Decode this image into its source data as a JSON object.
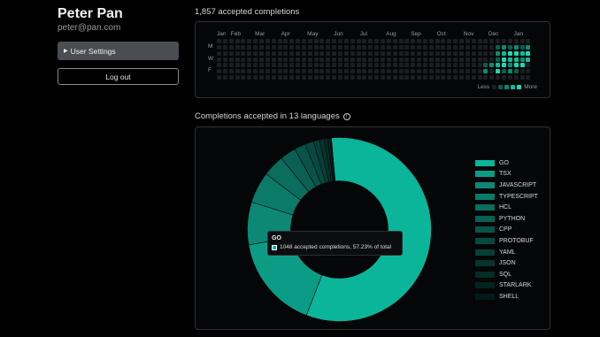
{
  "user": {
    "name": "Peter Pan",
    "email": "peter@pan.com",
    "settings_label": "User Settings",
    "logout_label": "Log out"
  },
  "activity": {
    "title": "1,857 accepted completions",
    "months": [
      "Jan",
      "Feb",
      "Mar",
      "Apr",
      "May",
      "Jun",
      "Jul",
      "Aug",
      "Sep",
      "Oct",
      "Nov",
      "Dec",
      "Jan"
    ],
    "day_labels": [
      "M",
      "W",
      "F"
    ],
    "legend_less": "Less",
    "legend_more": "More",
    "weeks": 52,
    "levels_by_week": {
      "44": [
        0,
        0,
        0,
        0,
        1,
        2,
        0
      ],
      "45": [
        0,
        0,
        0,
        0,
        2,
        0,
        0
      ],
      "46": [
        0,
        1,
        2,
        1,
        3,
        4,
        0
      ],
      "47": [
        0,
        2,
        3,
        4,
        4,
        1,
        0
      ],
      "48": [
        0,
        1,
        4,
        3,
        2,
        2,
        0
      ],
      "49": [
        0,
        2,
        4,
        3,
        4,
        1,
        0
      ],
      "50": [
        0,
        1,
        3,
        2,
        4,
        0,
        0
      ],
      "51": [
        0,
        2,
        4,
        3,
        0,
        0,
        0
      ]
    },
    "level_colors": [
      "#1c1e21",
      "#0b5e50",
      "#0d8a73",
      "#12b89a",
      "#19d9b5"
    ]
  },
  "languages": {
    "title": "Completions accepted in 13 languages",
    "info_icon": "info-icon",
    "tooltip": {
      "language": "GO",
      "text": "1048 accepted completions, 57.23% of total"
    }
  },
  "chart_data": {
    "type": "pie",
    "categories": [
      "GO",
      "TSX",
      "JAVASCRIPT",
      "TYPESCRIPT",
      "HCL",
      "PYTHON",
      "CPP",
      "PROTOBUF",
      "YAML",
      "JSON",
      "SQL",
      "STARLARK",
      "SHELL"
    ],
    "values": [
      57.23,
      16.5,
      7.5,
      5.5,
      3.8,
      2.8,
      2.0,
      1.5,
      1.1,
      0.8,
      0.6,
      0.4,
      0.27
    ],
    "colors": [
      "#0bb59a",
      "#0c9c85",
      "#0c8875",
      "#0b7a68",
      "#0a6d5d",
      "#096053",
      "#085449",
      "#07493f",
      "#063f37",
      "#05352e",
      "#052c27",
      "#04231f",
      "#031b18"
    ],
    "legend": "right"
  }
}
